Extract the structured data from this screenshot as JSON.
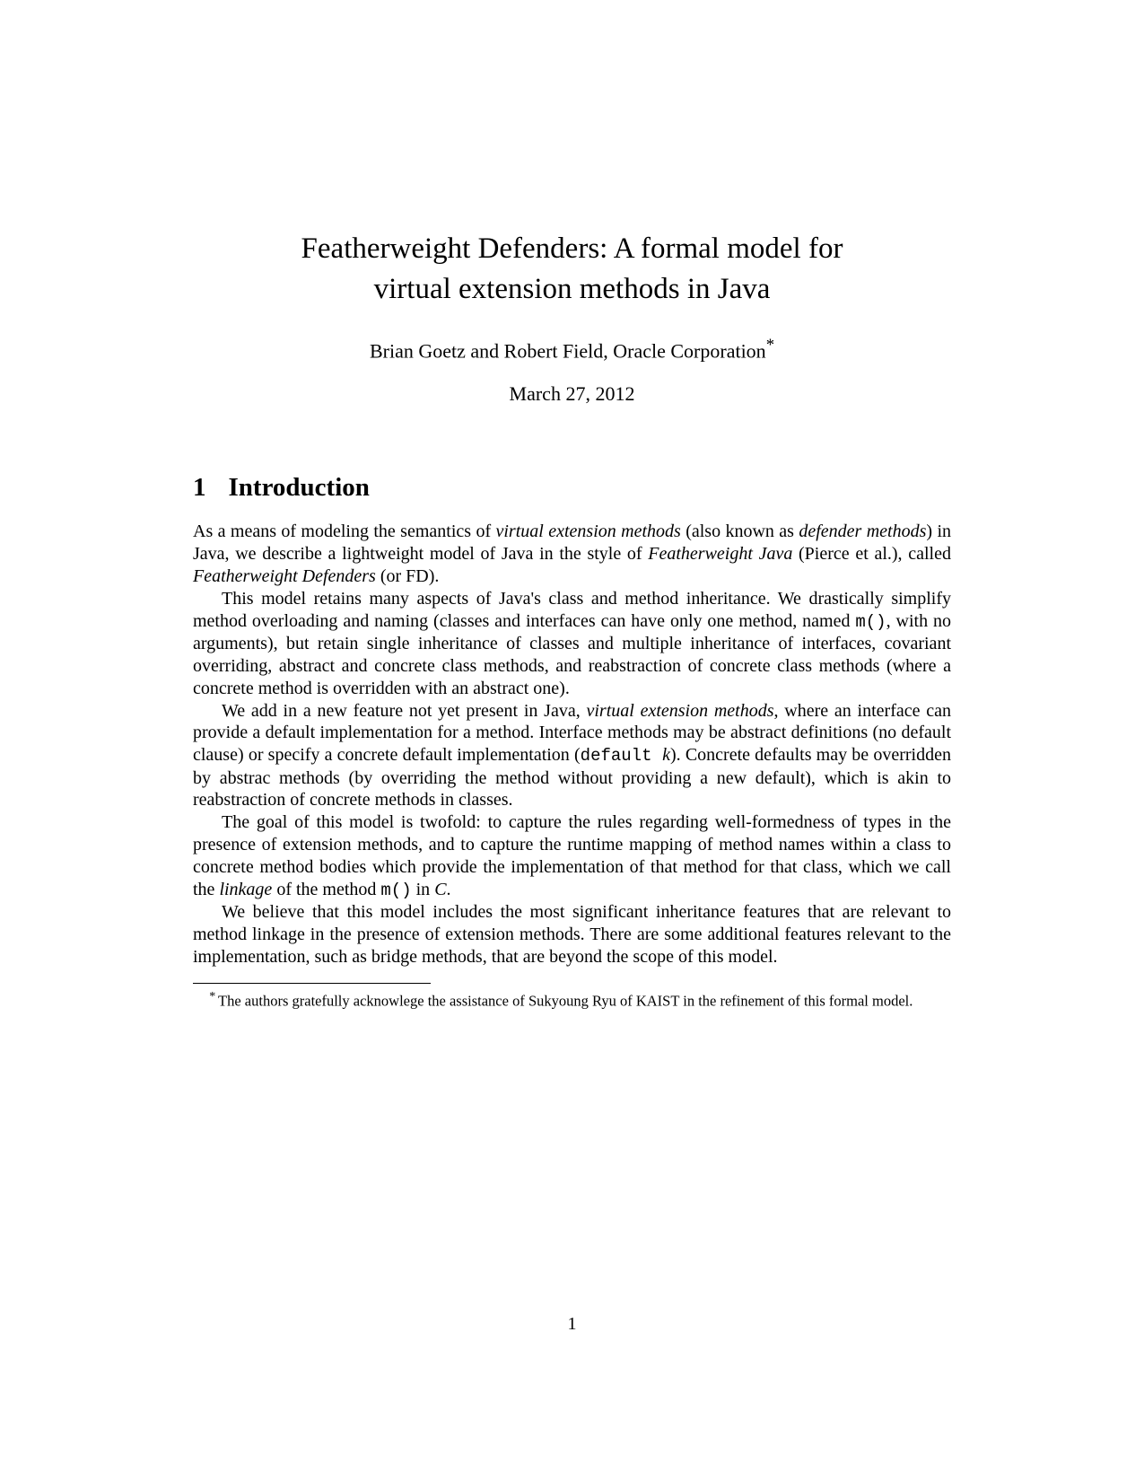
{
  "title_line1": "Featherweight Defenders: A formal model for",
  "title_line2": "virtual extension methods in Java",
  "authors": "Brian Goetz and Robert Field, Oracle Corporation",
  "authors_marker": "*",
  "date": "March 27, 2012",
  "section": {
    "number": "1",
    "label": "Introduction"
  },
  "p1_a": "As a means of modeling the semantics of ",
  "p1_b": "virtual extension methods",
  "p1_c": " (also known as ",
  "p1_d": "defender methods",
  "p1_e": ") in Java, we describe a lightweight model of Java in the style of ",
  "p1_f": "Featherweight Java",
  "p1_g": " (Pierce et al.), called ",
  "p1_h": "Featherweight Defenders",
  "p1_i": " (or FD).",
  "p2_a": "This model retains many aspects of Java's class and method inheritance. We drastically simplify method overloading and naming (classes and interfaces can have only one method, named ",
  "p2_b": "m()",
  "p2_c": ", with no arguments), but retain single inheritance of classes and multiple inheritance of interfaces, covariant overriding, abstract and concrete class methods, and reabstraction of concrete class methods (where a concrete method is overridden with an abstract one).",
  "p3_a": "We add in a new feature not yet present in Java, ",
  "p3_b": "virtual extension methods",
  "p3_c": ", where an interface can provide a default implementation for a method. Interface methods may be abstract definitions (no default clause) or specify a concrete default implementation (",
  "p3_d": "default ",
  "p3_e": "k",
  "p3_f": "). Concrete defaults may be overridden by abstrac methods (by overriding the method without providing a new default), which is akin to reabstraction of concrete methods in classes.",
  "p4_a": "The goal of this model is twofold: to capture the rules regarding well-formedness of types in the presence of extension methods, and to capture the runtime mapping of method names within a class to concrete method bodies which provide the implementation of that method for that class, which we call the ",
  "p4_b": "linkage",
  "p4_c": " of the method ",
  "p4_d": "m()",
  "p4_e": " in ",
  "p4_f": "C",
  "p4_g": ".",
  "p5": "We believe that this model includes the most significant inheritance features that are relevant to method linkage in the presence of extension methods. There are some additional features relevant to the implementation, such as bridge methods, that are beyond the scope of this model.",
  "footnote_marker": "*",
  "footnote_text": "The authors gratefully acknowlege the assistance of Sukyoung Ryu of KAIST in the refinement of this formal model.",
  "page_number": "1"
}
